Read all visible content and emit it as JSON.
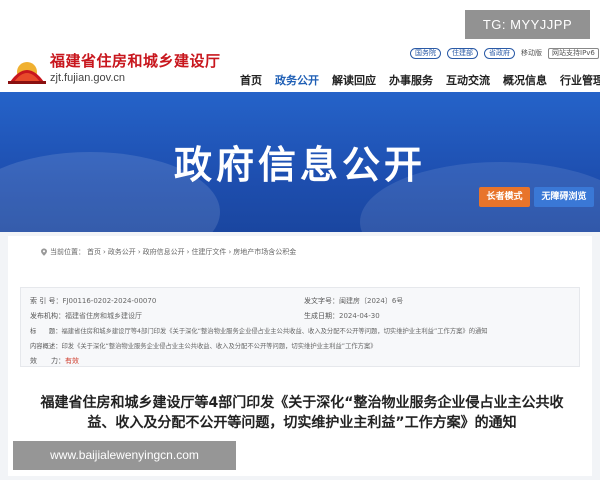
{
  "header": {
    "site_name": "福建省住房和城乡建设厅",
    "site_domain": "zjt.fujian.gov.cn",
    "top_links": [
      "国务院",
      "住建部",
      "省政府",
      "移动版",
      "网站支持IPv6"
    ],
    "nav": [
      "首页",
      "政务公开",
      "解读回应",
      "办事服务",
      "互动交流",
      "概况信息",
      "行业管理"
    ],
    "active_nav": "政务公开"
  },
  "watermark_top": "TG: MYYJJPP",
  "banner": {
    "title": "政府信息公开",
    "elder_mode": "长者模式",
    "accessible": "无障碍浏览"
  },
  "breadcrumb": {
    "label": "当前位置：",
    "items": [
      "首页",
      "政务公开",
      "政府信息公开",
      "住建厅文件",
      "房地产市场含公积金"
    ]
  },
  "meta": {
    "index_label": "索 引 号：",
    "index_value": "FJ00116-0202-2024-00070",
    "doc_no_label": "发文字号：",
    "doc_no_value": "闽建房〔2024〕6号",
    "issuer_label": "发布机构：",
    "issuer_value": "福建省住房和城乡建设厅",
    "date_label": "生成日期：",
    "date_value": "2024-04-30",
    "title_label": "标　　题：",
    "title_value": "福建省住房和城乡建设厅等4部门印发《关于深化“整治物业服务企业侵占业主公共收益、收入及分配不公开等问题，切实维护业主利益”工作方案》的通知",
    "summary_label": "内容概述：",
    "summary_value": "印发《关于深化“整治物业服务企业侵占业主公共收益、收入及分配不公开等问题，切实维护业主利益”工作方案》",
    "validity_label": "效　　力：",
    "validity_value": "有效"
  },
  "doc_title": "福建省住房和城乡建设厅等4部门印发《关于深化“整治物业服务企业侵占业主公共收益、收入及分配不公开等问题，切实维护业主利益”工作方案》的通知",
  "watermark_bottom": "www.baijialewenyingcn.com",
  "colors": {
    "brand_red": "#c8161d",
    "nav_active": "#1f5fb5",
    "banner_blue": "#2563c9",
    "elder_orange": "#e8742a",
    "access_blue": "#3a78d6"
  }
}
